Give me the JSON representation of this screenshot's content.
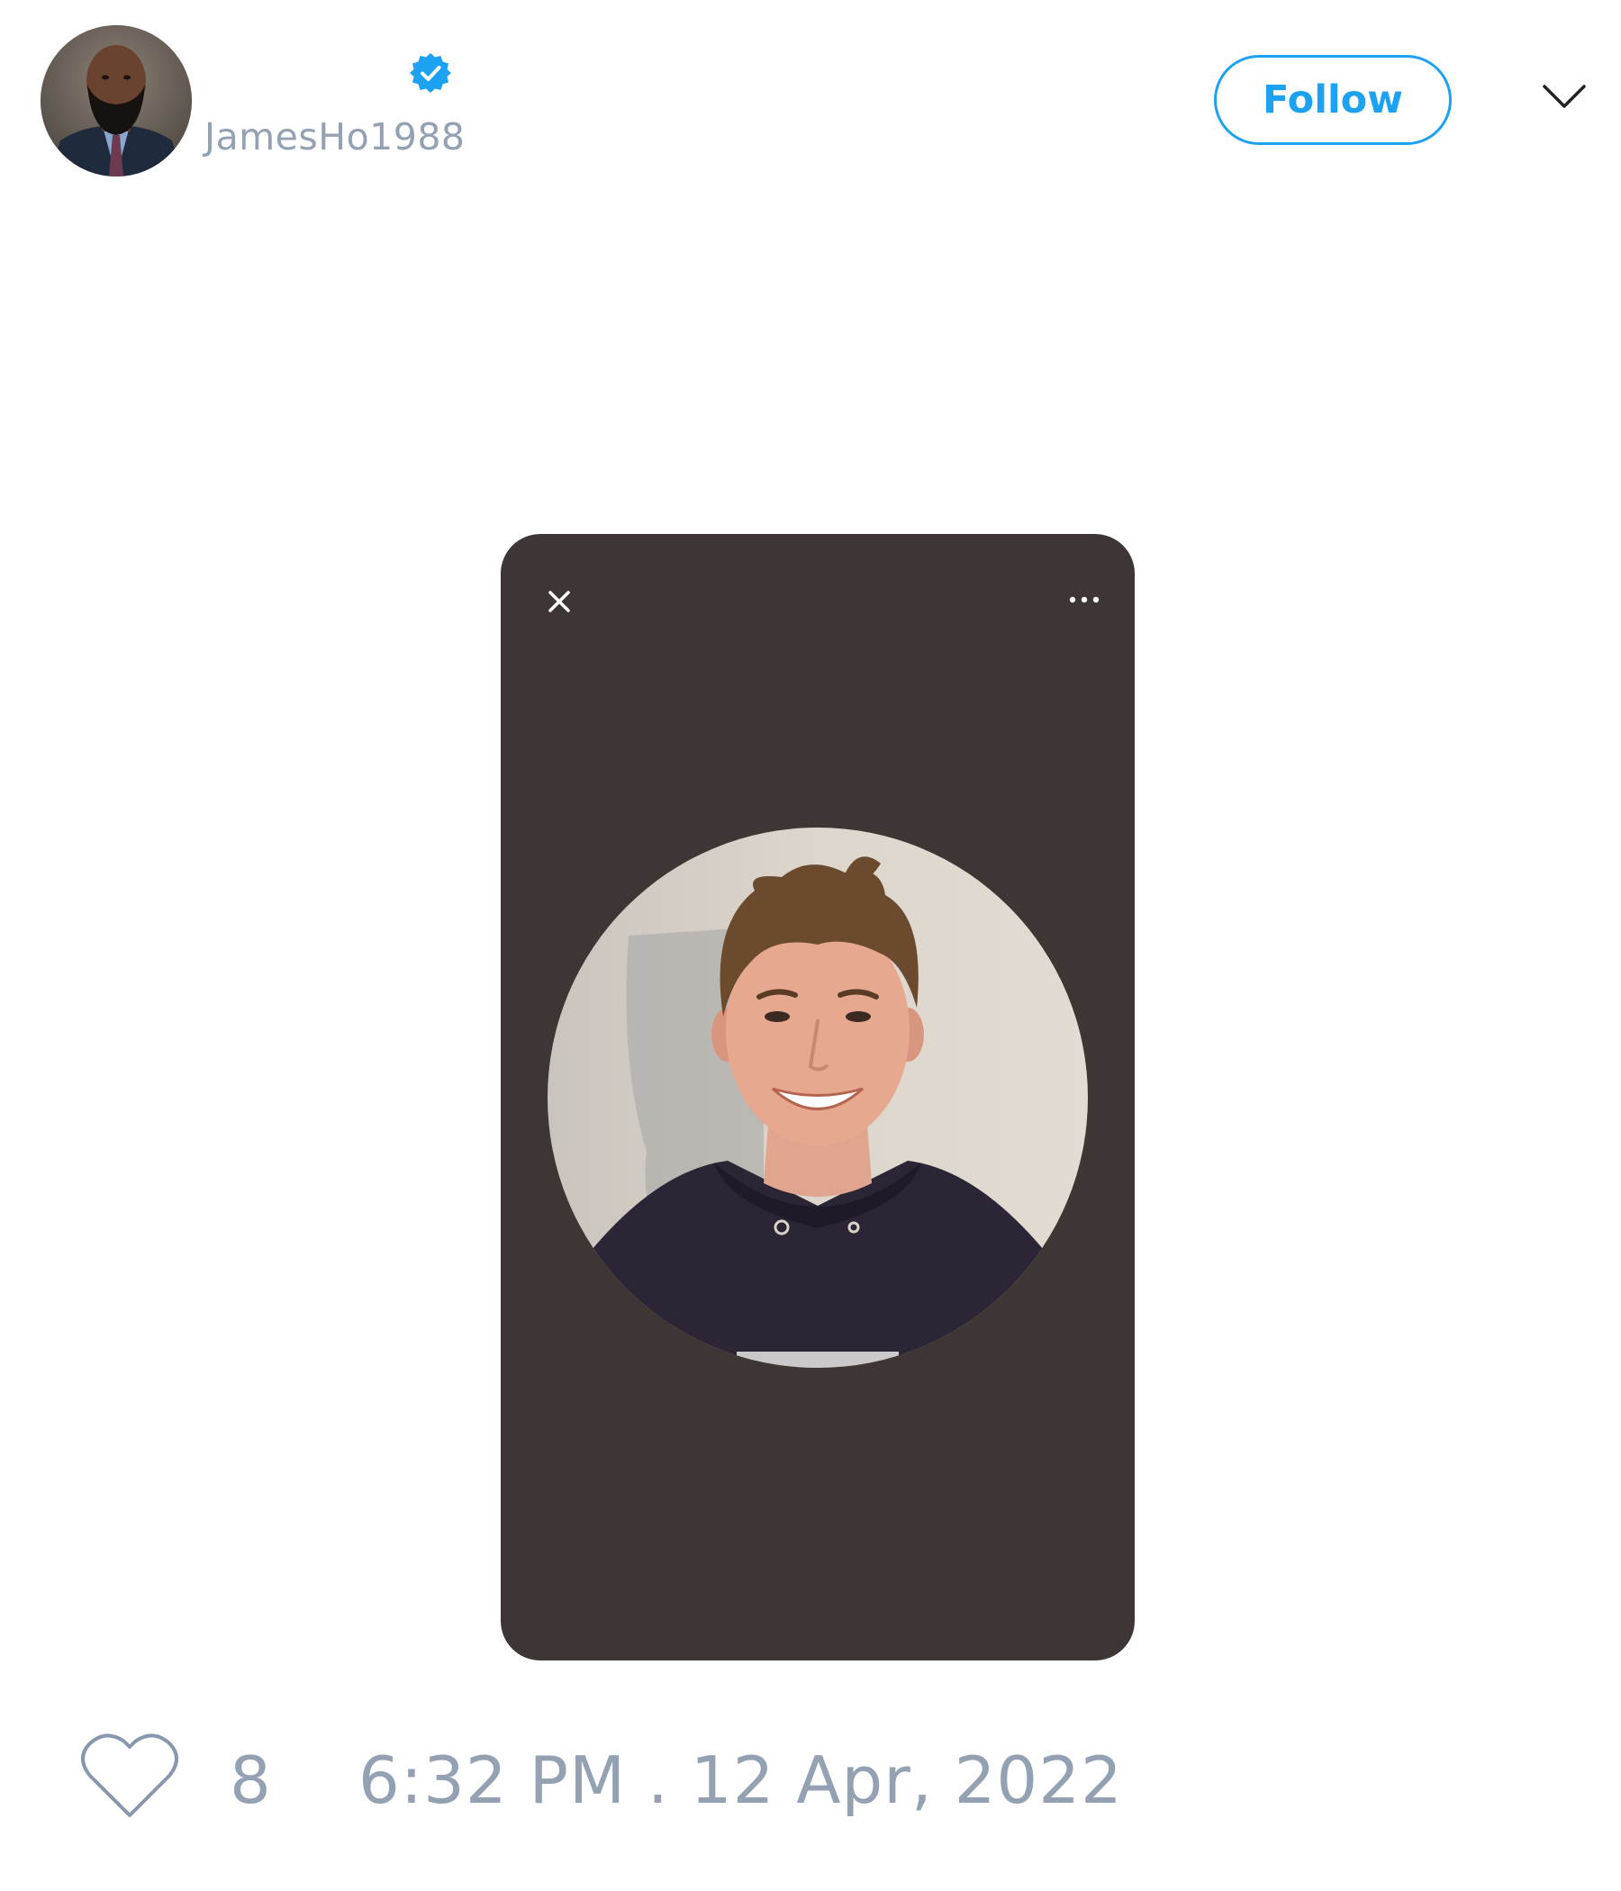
{
  "header": {
    "username": "JamesHo1988",
    "avatar_icon": "profile-photo",
    "verified_icon": "verified-badge-icon",
    "follow_label": "Follow",
    "menu_icon": "chevron-down-icon"
  },
  "media": {
    "close_icon": "close-icon",
    "more_icon": "more-horizontal-icon",
    "photo": "portrait-photo"
  },
  "footer": {
    "like_icon": "heart-icon",
    "like_count": "8",
    "timestamp": "6:32 PM . 12 Apr, 2022"
  },
  "colors": {
    "accent": "#1da1f2",
    "muted_text": "#93a1b3",
    "media_background": "#3e3635"
  }
}
